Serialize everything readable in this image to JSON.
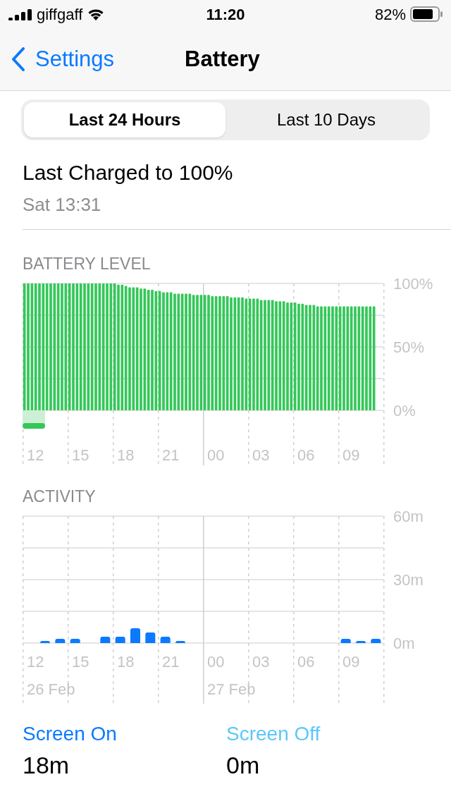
{
  "status_bar": {
    "carrier": "giffgaff",
    "time": "11:20",
    "battery": "82%"
  },
  "nav": {
    "back": "Settings",
    "title": "Battery"
  },
  "segments": [
    {
      "label": "Last 24 Hours",
      "selected": true
    },
    {
      "label": "Last 10 Days",
      "selected": false
    }
  ],
  "last_charged": {
    "title": "Last Charged to 100%",
    "time": "Sat 13:31"
  },
  "battery_level": {
    "header": "BATTERY LEVEL",
    "x_labels": [
      "12",
      "15",
      "18",
      "21",
      "00",
      "03",
      "06",
      "09"
    ],
    "chart_data": {
      "type": "bar",
      "ylim": [
        0,
        100
      ],
      "yticks": [
        {
          "value": 0,
          "label": "0%"
        },
        {
          "value": 50,
          "label": "50%"
        },
        {
          "value": 100,
          "label": "100%"
        }
      ],
      "series": [
        {
          "color": "#34c759",
          "values": [
            100,
            100,
            100,
            100,
            100,
            100,
            100,
            100,
            100,
            100,
            100,
            100,
            100,
            100,
            100,
            100,
            100,
            100,
            100,
            100,
            100,
            100,
            100,
            100,
            100,
            99,
            99,
            98,
            97,
            97,
            97,
            96,
            96,
            95,
            95,
            94,
            94,
            93,
            93,
            93,
            92,
            92,
            92,
            92,
            92,
            91,
            91,
            91,
            91,
            91,
            90,
            90,
            90,
            90,
            90,
            89,
            89,
            89,
            89,
            88,
            88,
            88,
            88,
            87,
            87,
            87,
            87,
            86,
            86,
            86,
            85,
            85,
            85,
            84,
            84,
            83,
            83,
            83,
            82,
            82,
            82,
            82,
            82,
            82,
            82,
            82,
            82,
            82,
            82,
            82,
            82,
            82,
            82,
            82
          ]
        }
      ]
    }
  },
  "activity": {
    "header": "ACTIVITY",
    "x_labels": [
      "12",
      "15",
      "18",
      "21",
      "00",
      "03",
      "06",
      "09"
    ],
    "chart_data": {
      "type": "bar",
      "ylim": [
        0,
        60
      ],
      "yticks": [
        {
          "value": 0,
          "label": "0m"
        },
        {
          "value": 30,
          "label": "30m"
        },
        {
          "value": 60,
          "label": "60m"
        }
      ],
      "series": [
        {
          "color": "#0a7aff",
          "values": [
            0,
            1,
            2,
            2,
            0,
            3,
            3,
            7,
            5,
            3,
            1,
            0,
            0,
            0,
            0,
            0,
            0,
            0,
            0,
            0,
            0,
            2,
            1,
            2
          ]
        }
      ]
    },
    "dates": [
      "26 Feb",
      "27 Feb"
    ]
  },
  "usage": [
    {
      "label": "Screen On",
      "value": "18m",
      "color": "#0a7aff"
    },
    {
      "label": "Screen Off",
      "value": "0m",
      "color": "#5ac8fa"
    }
  ]
}
